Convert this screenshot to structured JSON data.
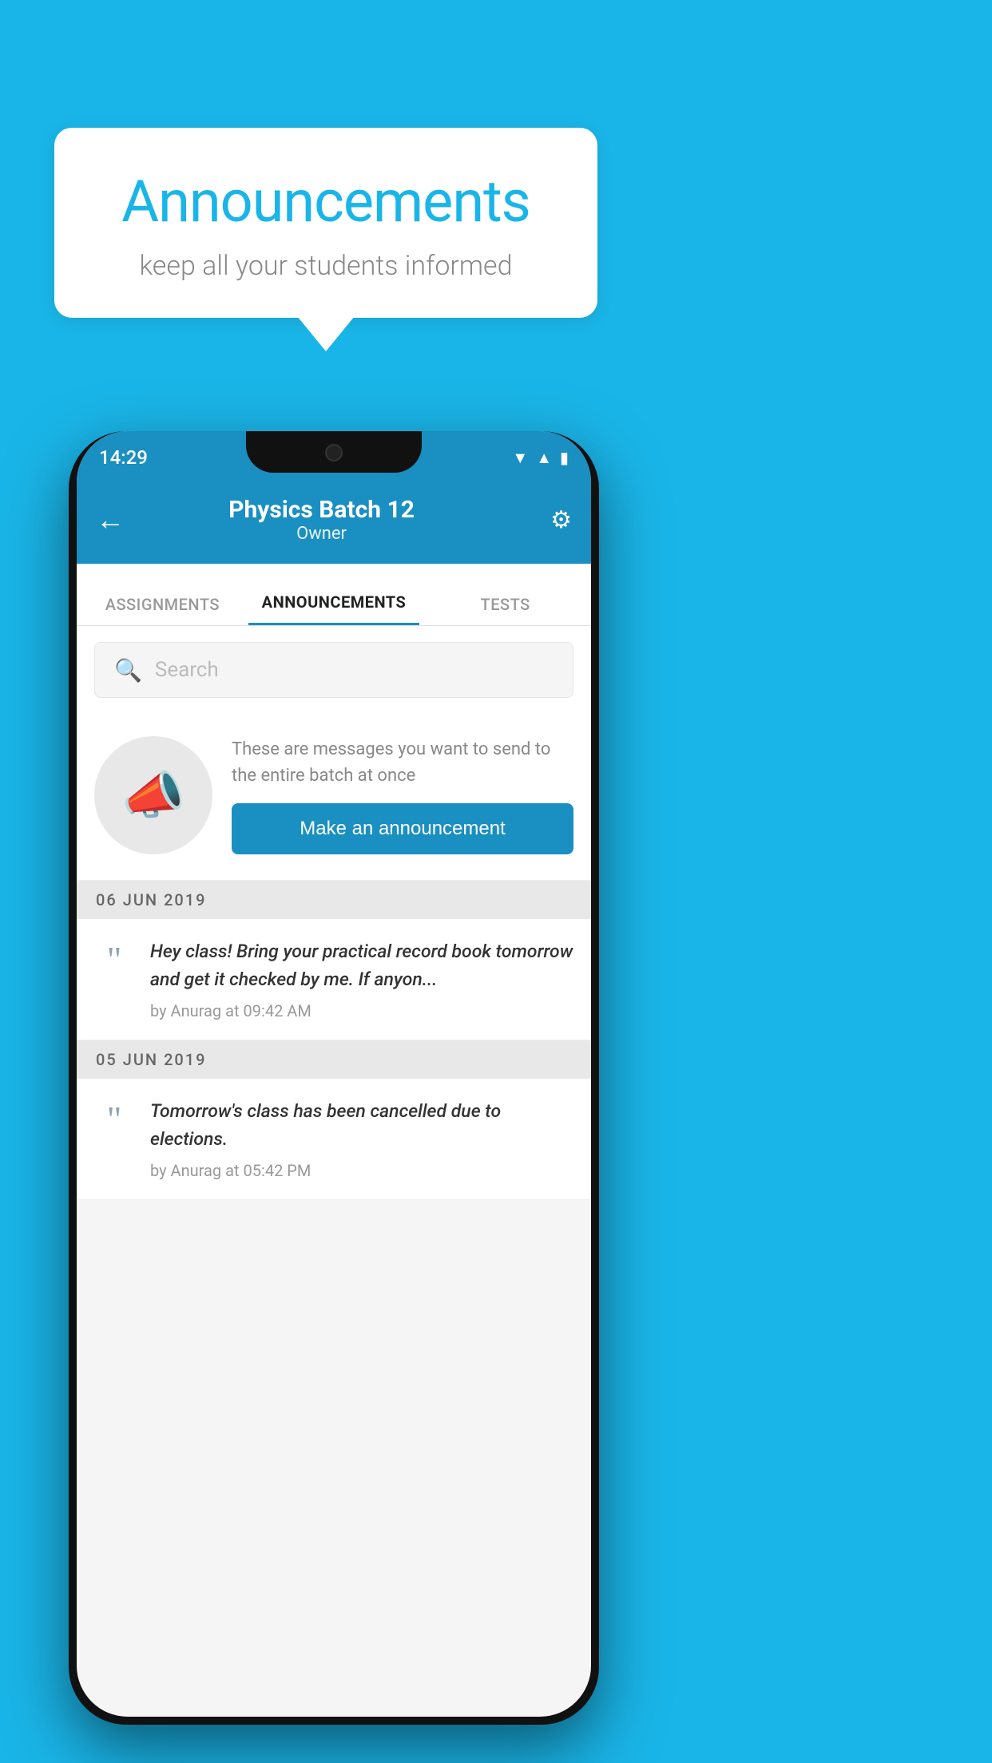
{
  "background_color": "#1ab5e8",
  "speech_bubble": {
    "title": "Announcements",
    "subtitle": "keep all your students informed"
  },
  "phone": {
    "status_bar": {
      "time": "14:29",
      "icons": [
        "wifi",
        "signal",
        "battery"
      ]
    },
    "app_bar": {
      "title": "Physics Batch 12",
      "subtitle": "Owner",
      "back_label": "←",
      "settings_label": "⚙"
    },
    "tabs": [
      {
        "label": "ASSIGNMENTS",
        "active": false
      },
      {
        "label": "ANNOUNCEMENTS",
        "active": true
      },
      {
        "label": "TESTS",
        "active": false
      }
    ],
    "search": {
      "placeholder": "Search"
    },
    "empty_state": {
      "description": "These are messages you want to send to the entire batch at once",
      "button_label": "Make an announcement"
    },
    "announcements": [
      {
        "date": "06  JUN  2019",
        "items": [
          {
            "text": "Hey class! Bring your practical record book tomorrow and get it checked by me. If anyon...",
            "meta": "by Anurag at 09:42 AM"
          }
        ]
      },
      {
        "date": "05  JUN  2019",
        "items": [
          {
            "text": "Tomorrow's class has been cancelled due to elections.",
            "meta": "by Anurag at 05:42 PM"
          }
        ]
      }
    ]
  }
}
